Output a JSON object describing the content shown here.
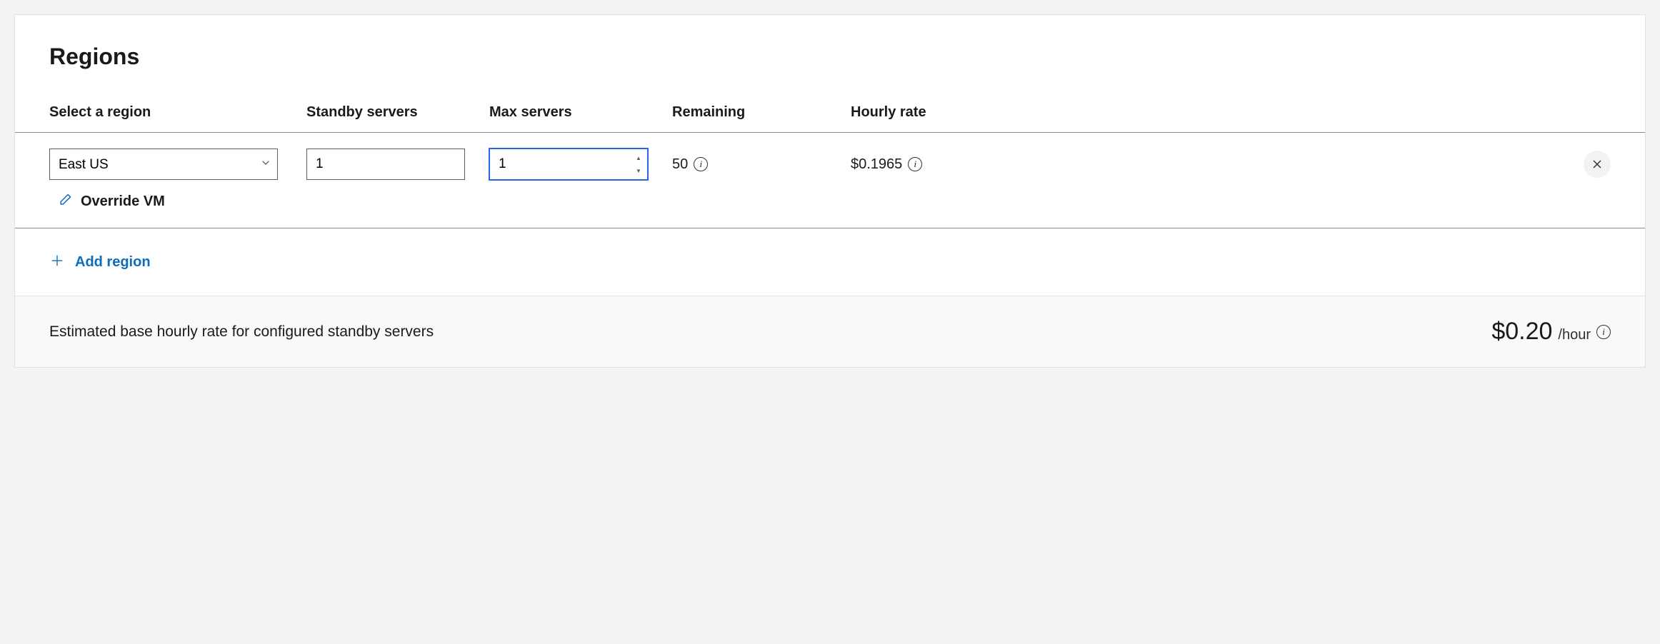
{
  "title": "Regions",
  "columns": {
    "region": "Select a region",
    "standby": "Standby servers",
    "max": "Max servers",
    "remaining": "Remaining",
    "rate": "Hourly rate"
  },
  "row": {
    "region": "East US",
    "standby": "1",
    "max": "1",
    "remaining": "50",
    "hourly_rate": "$0.1965"
  },
  "override_label": "Override VM",
  "add_region_label": "Add region",
  "footer": {
    "text": "Estimated base hourly rate for configured standby servers",
    "amount": "$0.20",
    "per": "/hour"
  }
}
